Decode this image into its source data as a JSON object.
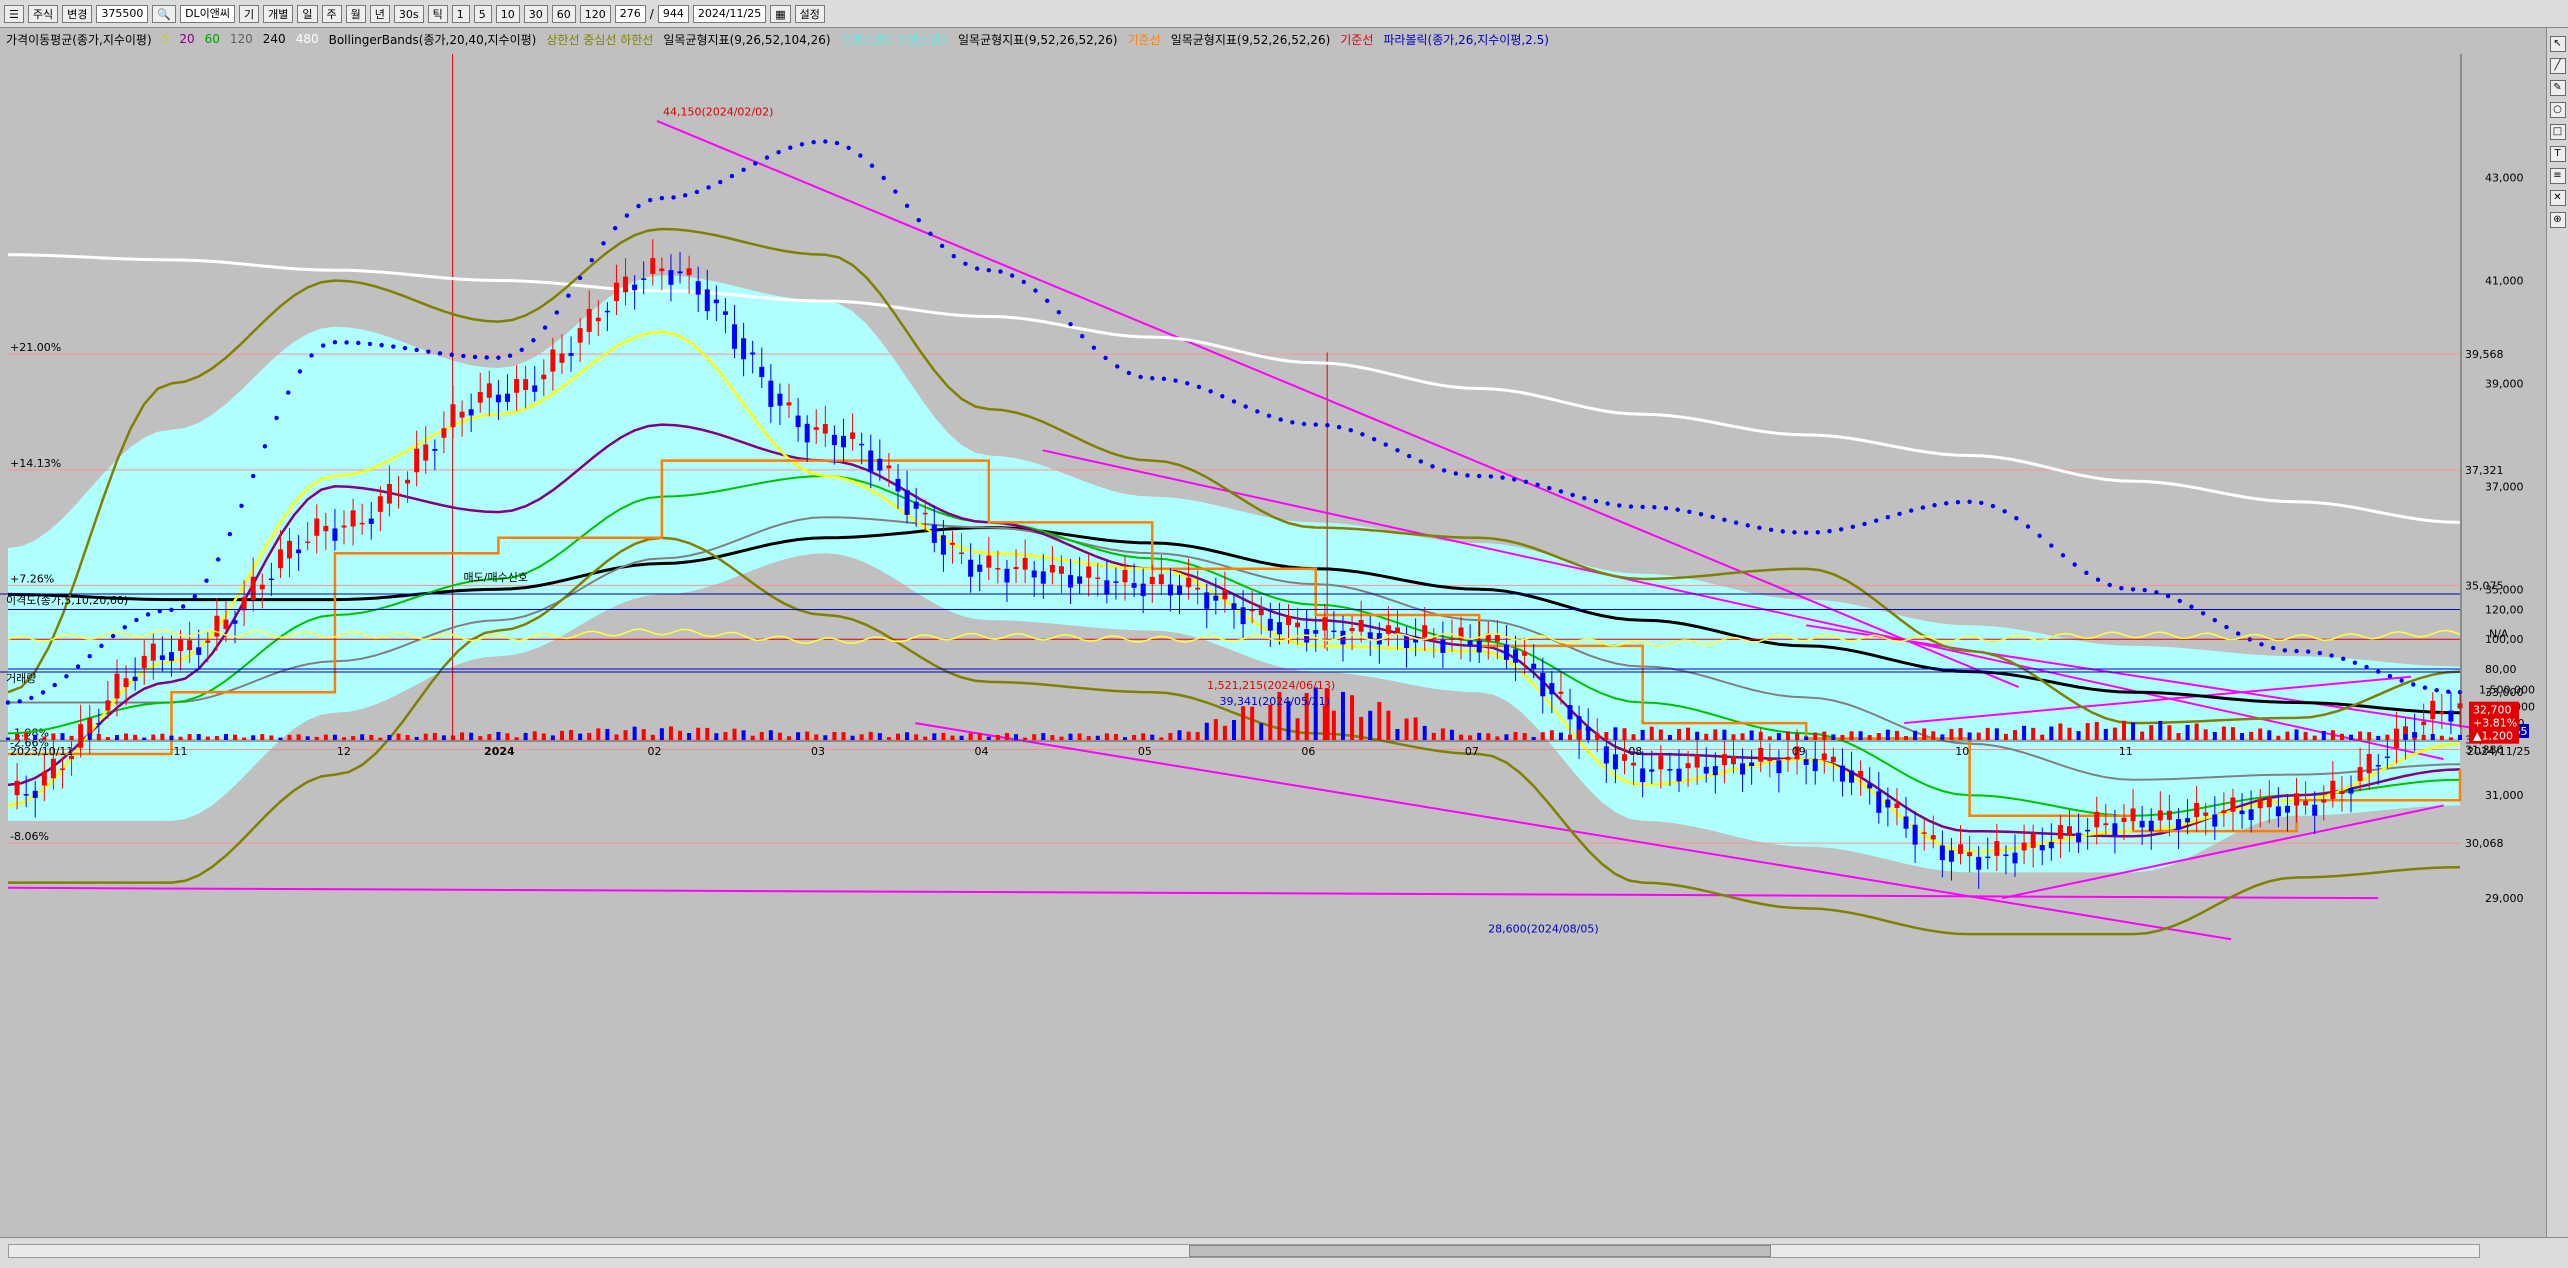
{
  "toolbar": {
    "tab_stock": "주식",
    "mode": "변경",
    "code": "375500",
    "name": "DL이앤씨",
    "periods": [
      "기",
      "개별",
      "일",
      "주",
      "월",
      "년",
      "30s",
      "틱"
    ],
    "minutes": [
      "1",
      "5",
      "10",
      "30",
      "60",
      "120"
    ],
    "count": "276",
    "total": "944",
    "date": "2024/11/25",
    "settings": "설정"
  },
  "legend": {
    "ma": "가격이동평균(종가,지수이평)",
    "ma_periods": [
      "5",
      "20",
      "60",
      "120",
      "240",
      "480"
    ],
    "bollinger": "BollingerBands(종가,20,40,지수이평)",
    "bollinger_bands": "상한선 중심선 하한선",
    "ichimoku_a": "일목균형지표(9,26,52,104,26)",
    "ichimoku_a_parts": "선행스팬1 선행스팬2",
    "ichimoku_b": "일목균형지표(9,52,26,52,26)",
    "ichimoku_b_part": "기준선",
    "ichimoku_c": "일목균형지표(9,52,26,52,26)",
    "ichimoku_c_part": "기준선",
    "parabolic": "파라볼릭(종가,26,지수이평,2.5)"
  },
  "chart_data": [
    {
      "type": "candlestick",
      "x_ticks": [
        "2023/10/11",
        "11",
        "12",
        "2024",
        "02",
        "03",
        "04",
        "05",
        "06",
        "07",
        "08",
        "09",
        "10",
        "11",
        "2024/11/25"
      ],
      "y_ticks": [
        29000,
        31000,
        33000,
        35000,
        37000,
        39000,
        41000,
        43000
      ],
      "y_tick_labels": [
        "29,000",
        "31,000",
        "33,000",
        "35,000",
        "37,000",
        "39,000",
        "41,000",
        "43,000"
      ],
      "ylim": [
        27700,
        45400
      ],
      "percent_levels": [
        {
          "label": "+21.00%",
          "price": 39568,
          "price_label": "39,568"
        },
        {
          "label": "+14.13%",
          "price": 37321,
          "price_label": "37,321"
        },
        {
          "label": "+7.26%",
          "price": 35075,
          "price_label": "35,075"
        },
        {
          "label": "-1.98%",
          "price": 32085,
          "price_label": "32,085"
        },
        {
          "label": "-2.66%",
          "price": 31886,
          "price_label": "31,886"
        },
        {
          "label": "-8.06%",
          "price": 30068,
          "price_label": "30,068"
        }
      ],
      "annotations": [
        {
          "text": "44,150(2024/02/02)",
          "month_index": 3.97,
          "price": 44150
        },
        {
          "text": "28,600(2024/08/05)",
          "month_index": 9.85,
          "price": 28600
        },
        {
          "text": "매도/매수신호",
          "month_index": 2.75,
          "price": 35100
        }
      ],
      "current": {
        "price_label": "32,700",
        "change_label": "+3.81%",
        "diff_label": "▲1,200"
      },
      "monthly_closes": [
        31000,
        33800,
        36200,
        38800,
        41200,
        38000,
        35400,
        35100,
        34200,
        34000,
        31500,
        31700,
        29800,
        30500,
        30800,
        32700
      ],
      "ma5": [
        30800,
        33600,
        37200,
        38400,
        40000,
        37200,
        35700,
        35400,
        33900,
        33800,
        31200,
        31700,
        29900,
        30300,
        30900,
        32000
      ],
      "ma20": [
        31200,
        33200,
        37000,
        36500,
        38200,
        37500,
        36300,
        35400,
        34400,
        33900,
        31800,
        31700,
        30300,
        30200,
        31000,
        31500
      ],
      "ma60": [
        32200,
        32800,
        34500,
        35200,
        36800,
        37200,
        36300,
        35600,
        34700,
        34000,
        32800,
        32200,
        31000,
        30600,
        31000,
        31300
      ],
      "ma120": [
        32800,
        32800,
        33600,
        34400,
        35600,
        36400,
        36200,
        35700,
        35100,
        34400,
        33500,
        32900,
        32000,
        31300,
        31400,
        31600
      ],
      "ma240": [
        34900,
        34800,
        34800,
        35000,
        35500,
        36000,
        36200,
        35900,
        35400,
        35000,
        34400,
        33900,
        33400,
        33000,
        32800,
        32600
      ],
      "ma480": [
        41500,
        41400,
        41200,
        41000,
        40800,
        40600,
        40300,
        39900,
        39400,
        38900,
        38400,
        38000,
        37600,
        37100,
        36700,
        36300
      ],
      "boll_upper": [
        33000,
        39000,
        41000,
        40200,
        42000,
        41500,
        38500,
        37500,
        36200,
        36000,
        35200,
        35400,
        33800,
        32400,
        32500,
        33400
      ],
      "boll_lower": [
        29300,
        29300,
        31400,
        34200,
        36000,
        34500,
        33200,
        33000,
        32200,
        31800,
        29300,
        28800,
        28300,
        28300,
        29400,
        29600
      ],
      "parabolic": [
        32800,
        34600,
        39800,
        39500,
        42600,
        43700,
        41200,
        39100,
        38200,
        37200,
        36600,
        36100,
        36700,
        35000,
        33800,
        33000
      ]
    },
    {
      "type": "line",
      "title": "이격도(종가,5,10,20,60)",
      "y_ticks": [
        80,
        100,
        120
      ],
      "y_tick_labels": [
        "80,00",
        "100,00",
        "120,00"
      ],
      "ylim": [
        78,
        123
      ],
      "value_label": "N/A",
      "values": [
        100,
        104,
        103,
        101,
        105,
        99,
        102,
        100,
        101,
        102,
        97,
        101,
        100,
        103,
        101,
        104
      ]
    },
    {
      "type": "bar",
      "title": "거래량",
      "y_tick_labels": [
        "500,000",
        "1,000,000",
        "1,500,000"
      ],
      "y_ticks": [
        500000,
        1000000,
        1500000
      ],
      "ylim": [
        0,
        1700000
      ],
      "current_label": "161,065",
      "annotations": [
        {
          "text": "1,521,215(2024/06/13)",
          "month_index": 8.07,
          "value": 1521215
        },
        {
          "text": "39,341(2024/05/21)",
          "month_index": 7.35,
          "value": 39341
        }
      ],
      "values": [
        210000,
        180000,
        160000,
        230000,
        390000,
        240000,
        200000,
        190000,
        1521215,
        210000,
        380000,
        240000,
        350000,
        560000,
        300000,
        161065
      ]
    }
  ],
  "colors": {
    "candle_up": "#ff0000",
    "candle_down": "#0000ff",
    "ma5": "#ffff00",
    "ma20": "#800080",
    "ma60": "#00c000",
    "ma120": "#808080",
    "ma240": "#000000",
    "ma480": "#ffffff",
    "bollinger": "#808000",
    "cloud": "#b0ffff",
    "kijun": "#ff8000",
    "parabolic": "#0000ff",
    "trendline": "#ff00ff"
  }
}
